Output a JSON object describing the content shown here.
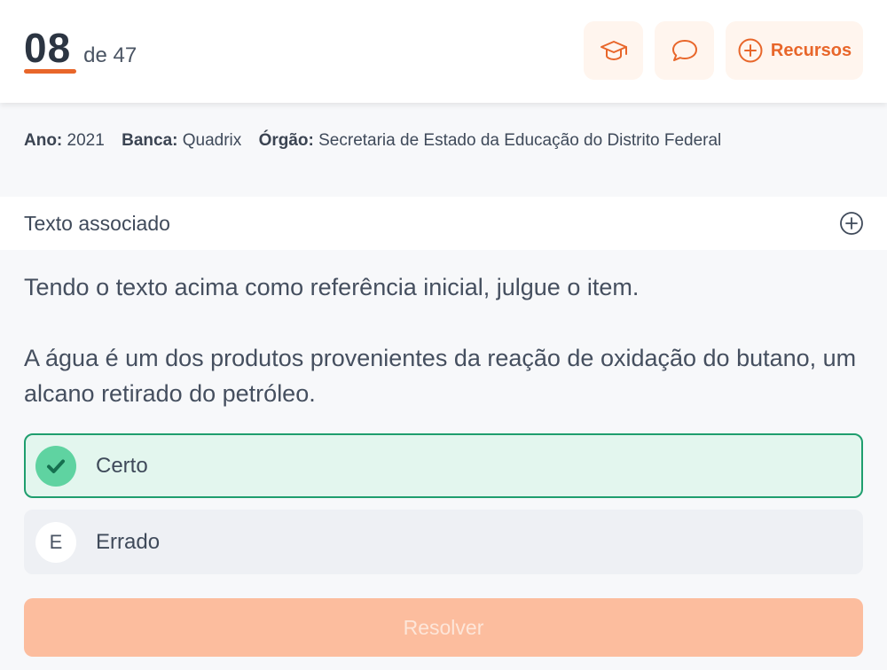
{
  "header": {
    "current_question": "08",
    "total_label": "de 47",
    "resources_label": "Recursos",
    "accent_color": "#e8662a",
    "icons": [
      "graduation-cap-icon",
      "chat-bubble-icon",
      "plus-circle-icon"
    ]
  },
  "meta": {
    "year_label": "Ano:",
    "year_value": "2021",
    "board_label": "Banca:",
    "board_value": "Quadrix",
    "organ_label": "Órgão:",
    "organ_value": "Secretaria de Estado da Educação do Distrito Federal"
  },
  "associated_text": {
    "label": "Texto associado",
    "icon": "plus-circle-icon"
  },
  "question": {
    "intro": "Tendo o texto acima como referência inicial, julgue o item.",
    "statement": "A água é um dos produtos provenientes da reação de oxidação do butano, um alcano retirado do petróleo."
  },
  "options": [
    {
      "badge": "check-icon",
      "label": "Certo",
      "selected": true,
      "color": "#1f9e6e"
    },
    {
      "badge": "E",
      "label": "Errado",
      "selected": false
    }
  ],
  "actions": {
    "resolve_label": "Resolver",
    "resolve_color": "#fcbd9e"
  }
}
